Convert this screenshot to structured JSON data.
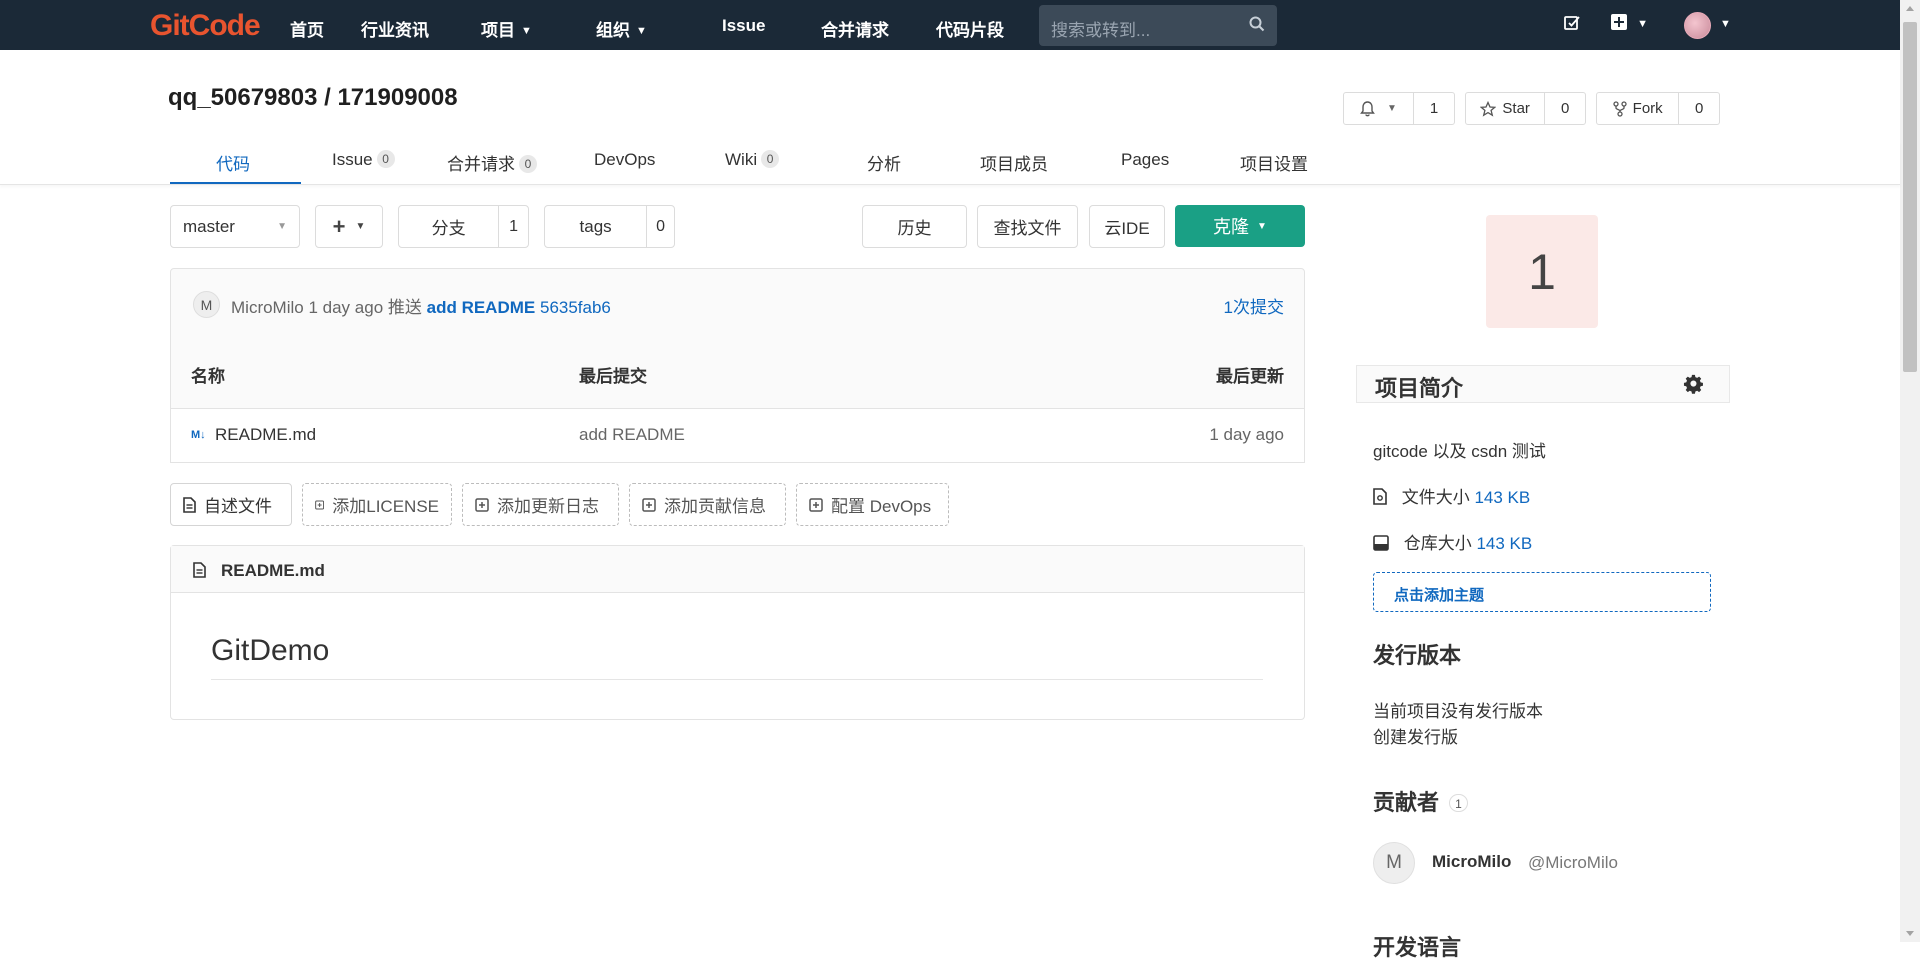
{
  "topnav": {
    "logo": "GitCode",
    "items": [
      {
        "label": "首页"
      },
      {
        "label": "行业资讯"
      },
      {
        "label": "项目"
      },
      {
        "label": "组织"
      },
      {
        "label": "Issue"
      },
      {
        "label": "合并请求"
      },
      {
        "label": "代码片段"
      }
    ],
    "search_placeholder": "搜索或转到..."
  },
  "repo": {
    "title": "qq_50679803 / 171909008",
    "notify_count": "1",
    "star_label": "Star",
    "star_count": "0",
    "fork_label": "Fork",
    "fork_count": "0"
  },
  "tabs": [
    {
      "label": "代码"
    },
    {
      "label": "Issue",
      "badge": "0"
    },
    {
      "label": "合并请求",
      "badge": "0"
    },
    {
      "label": "DevOps"
    },
    {
      "label": "Wiki",
      "badge": "0"
    },
    {
      "label": "分析"
    },
    {
      "label": "项目成员"
    },
    {
      "label": "Pages"
    },
    {
      "label": "项目设置"
    }
  ],
  "toolbar": {
    "branch": "master",
    "branches_label": "分支",
    "branches_count": "1",
    "tags_label": "tags",
    "tags_count": "0",
    "history": "历史",
    "find_file": "查找文件",
    "cloud_ide": "云IDE",
    "clone": "克隆"
  },
  "commit": {
    "avatar": "M",
    "author": "MicroMilo",
    "time": "1 day ago",
    "action": "推送",
    "message": "add README",
    "sha": "5635fab6",
    "count_link": "1次提交"
  },
  "file_table": {
    "headers": [
      "名称",
      "最后提交",
      "最后更新"
    ],
    "rows": [
      {
        "icon": "M↓",
        "name": "README.md",
        "last_commit": "add README",
        "updated": "1 day ago"
      }
    ]
  },
  "actions": [
    {
      "label": "自述文件"
    },
    {
      "label": "添加LICENSE"
    },
    {
      "label": "添加更新日志"
    },
    {
      "label": "添加贡献信息"
    },
    {
      "label": "配置 DevOps"
    }
  ],
  "readme": {
    "filename": "README.md",
    "heading": "GitDemo"
  },
  "sidebar": {
    "project_avatar": "1",
    "intro_title": "项目简介",
    "description": "gitcode 以及 csdn 测试",
    "file_size_label": "文件大小",
    "file_size": "143 KB",
    "repo_size_label": "仓库大小",
    "repo_size": "143 KB",
    "add_topic": "点击添加主题",
    "releases_title": "发行版本",
    "no_releases": "当前项目没有发行版本",
    "create_release": "创建发行版",
    "contributors_title": "贡献者",
    "contributors_count": "1",
    "contributor": {
      "avatar": "M",
      "name": "MicroMilo",
      "handle": "@MicroMilo"
    },
    "next_section_partial": "开发语言"
  },
  "colors": {
    "nav_bg": "#1b2937",
    "accent": "#1068bf",
    "clone_green": "#1aa085",
    "logo_orange": "#e8542f"
  }
}
